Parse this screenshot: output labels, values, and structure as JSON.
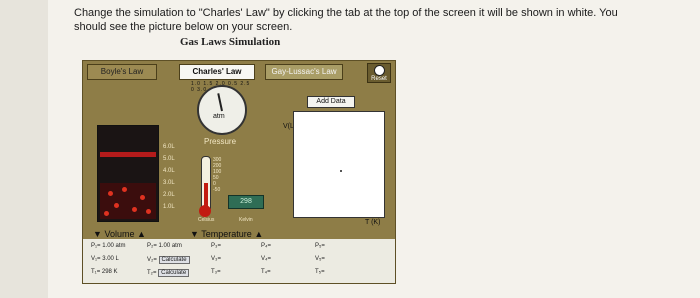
{
  "instruction": "Change the simulation to \"Charles' Law\" by clicking the tab at the top of the screen it will be shown in white. You should see the picture below on your screen.",
  "subtitle": "Gas Laws Simulation",
  "tabs": {
    "boyle": "Boyle's Law",
    "charles": "Charles' Law",
    "gay": "Gay-Lussac's Law"
  },
  "reset_label": "Reset",
  "gauge": {
    "ticks": "1.0 1.5 2.0 0.5 2.5 0 3.0",
    "unit": "atm",
    "label": "Pressure",
    "needle_value": 1.0
  },
  "add_data": "Add Data",
  "graph": {
    "y_label": "V(L)",
    "x_label": "T (K)"
  },
  "volume_scale": [
    "6.0L",
    "5.0L",
    "4.0L",
    "3.0L",
    "2.0L",
    "1.0L"
  ],
  "temp_scale": [
    "300",
    "200",
    "100",
    "50",
    "0",
    "-50"
  ],
  "temperature_box": "298",
  "units": {
    "celsius": "Celsius",
    "kelvin": "Kelvin"
  },
  "controls": {
    "volume": "Volume",
    "temperature": "Temperature"
  },
  "table": {
    "col1": {
      "p": "P₁= 1.00 atm",
      "v": "V₁= 3.00 L",
      "t": "T₁= 298 K"
    },
    "col2": {
      "p": "P₂= 1.00 atm",
      "v": "V₂=",
      "t": "T₂="
    },
    "calculate": "Calculate",
    "col3": {
      "p": "P₃=",
      "v": "V₃=",
      "t": "T₃="
    },
    "col4": {
      "p": "P₄=",
      "v": "V₄=",
      "t": "T₄="
    },
    "col5": {
      "p": "P₅=",
      "v": "V₅=",
      "t": "T₅="
    }
  }
}
